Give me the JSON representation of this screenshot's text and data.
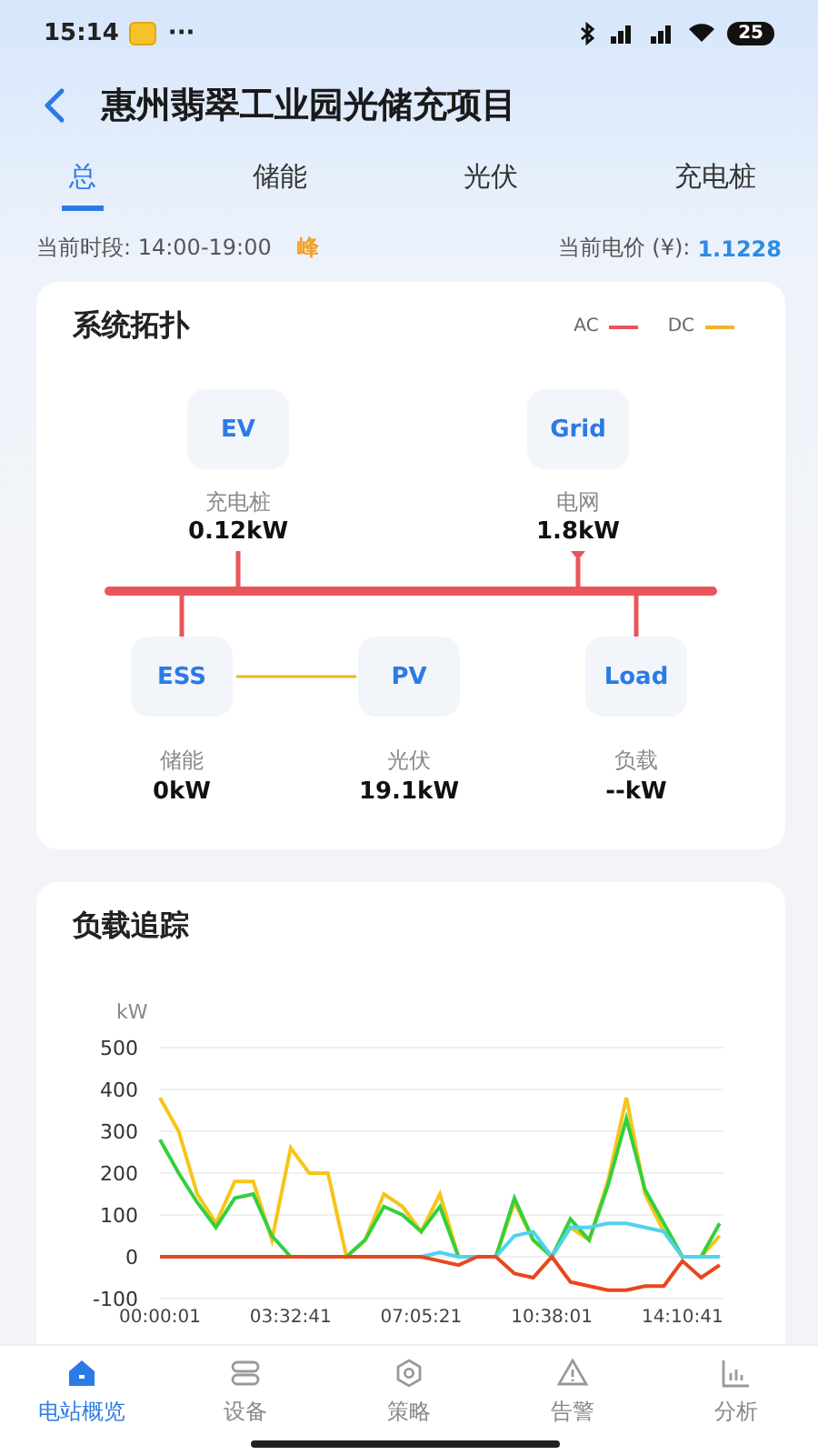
{
  "status_bar": {
    "time": "15:14",
    "more": "···",
    "battery": "25"
  },
  "header": {
    "title": "惠州翡翠工业园光储充项目"
  },
  "tabs": [
    {
      "label": "总",
      "selected": true
    },
    {
      "label": "储能",
      "selected": false
    },
    {
      "label": "光伏",
      "selected": false
    },
    {
      "label": "充电桩",
      "selected": false
    }
  ],
  "info": {
    "period_label": "当前时段: 14:00-19:00",
    "period_badge": "峰",
    "price_label": "当前电价 (¥):",
    "price_value": "1.1228"
  },
  "topology": {
    "title": "系统拓扑",
    "legend": [
      {
        "label": "AC",
        "color": "#e8565a"
      },
      {
        "label": "DC",
        "color": "#f0b429"
      }
    ],
    "nodes": [
      {
        "label": "EV",
        "name": "充电桩",
        "value": "0.12kW"
      },
      {
        "label": "Grid",
        "name": "电网",
        "value": "1.8kW"
      },
      {
        "label": "ESS",
        "name": "储能",
        "value": "0kW"
      },
      {
        "label": "PV",
        "name": "光伏",
        "value": "19.1kW"
      },
      {
        "label": "Load",
        "name": "负载",
        "value": "--kW"
      }
    ]
  },
  "load_tracking": {
    "title": "负载追踪",
    "chart_data": {
      "type": "line",
      "ylabel": "kW",
      "ylim": [
        -100,
        500
      ],
      "categories": [
        "00:00:01",
        null,
        null,
        null,
        null,
        null,
        null,
        "03:32:41",
        null,
        null,
        null,
        null,
        null,
        null,
        "07:05:21",
        null,
        null,
        null,
        null,
        null,
        null,
        "10:38:01",
        null,
        null,
        null,
        null,
        null,
        null,
        "14:10:41",
        null,
        null
      ],
      "series": [
        {
          "color": "#f5c518",
          "values": [
            380,
            300,
            150,
            80,
            180,
            180,
            40,
            260,
            200,
            200,
            0,
            40,
            150,
            120,
            60,
            150,
            0,
            0,
            0,
            130,
            40,
            0,
            70,
            40,
            180,
            380,
            150,
            60,
            0,
            0,
            50
          ]
        },
        {
          "color": "#34d03c",
          "values": [
            280,
            200,
            130,
            70,
            140,
            150,
            50,
            0,
            0,
            0,
            0,
            40,
            120,
            100,
            60,
            120,
            0,
            0,
            0,
            140,
            40,
            0,
            90,
            40,
            170,
            330,
            160,
            80,
            0,
            0,
            80
          ]
        },
        {
          "color": "#4fd2f0",
          "values": [
            null,
            null,
            null,
            null,
            null,
            null,
            null,
            null,
            null,
            null,
            null,
            null,
            null,
            null,
            0,
            10,
            0,
            0,
            0,
            50,
            60,
            0,
            70,
            70,
            80,
            80,
            70,
            60,
            0,
            0,
            0
          ]
        },
        {
          "color": "#e8471c",
          "values": [
            0,
            0,
            0,
            0,
            0,
            0,
            0,
            0,
            0,
            0,
            0,
            0,
            0,
            0,
            0,
            -10,
            -20,
            0,
            0,
            -40,
            -50,
            0,
            -60,
            -70,
            -80,
            -80,
            -70,
            -70,
            -10,
            -50,
            -20
          ]
        }
      ],
      "yticks": [
        -100,
        0,
        100,
        200,
        300,
        400,
        500
      ],
      "grid": true
    }
  },
  "bottom_nav": [
    {
      "label": "电站概览",
      "selected": true,
      "kind": "home"
    },
    {
      "label": "设备",
      "selected": false,
      "kind": "device"
    },
    {
      "label": "策略",
      "selected": false,
      "kind": "strategy"
    },
    {
      "label": "告警",
      "selected": false,
      "kind": "alarm"
    },
    {
      "label": "分析",
      "selected": false,
      "kind": "analysis"
    }
  ]
}
